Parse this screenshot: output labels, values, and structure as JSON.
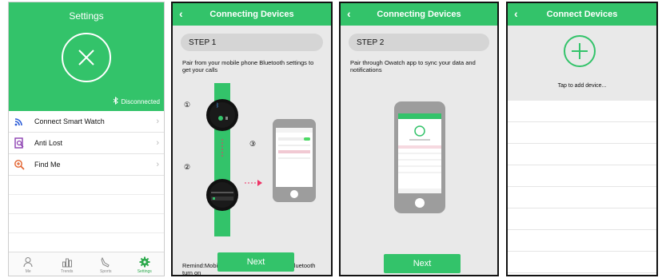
{
  "panel1": {
    "title": "Settings",
    "status": "Disconnected",
    "items": [
      {
        "label": "Connect Smart Watch",
        "icon": "wifi-signal-icon"
      },
      {
        "label": "Anti Lost",
        "icon": "anti-lost-icon"
      },
      {
        "label": "Find Me",
        "icon": "find-me-icon"
      }
    ],
    "tabs": [
      {
        "label": "Me",
        "icon": "person-icon"
      },
      {
        "label": "Trends",
        "icon": "bar-chart-icon"
      },
      {
        "label": "Sports",
        "icon": "shoe-icon"
      },
      {
        "label": "Settings",
        "icon": "gear-icon"
      }
    ]
  },
  "panel2": {
    "title": "Connecting Devices",
    "step": "STEP 1",
    "description": "Pair from your mobile phone Bluetooth settings to get your calls",
    "markers": [
      "①",
      "②",
      "③"
    ],
    "remind": "Remind:Mobile Phone and Smart Watch bluetooth turn on",
    "next": "Next"
  },
  "panel3": {
    "title": "Connecting Devices",
    "step": "STEP 2",
    "description": "Pair through Owatch app to sync your data and notifications",
    "next": "Next"
  },
  "panel4": {
    "title": "Connect Devices",
    "tap": "Tap to add device..."
  },
  "colors": {
    "accent": "#33c36a",
    "gray": "#e9e9e9"
  }
}
